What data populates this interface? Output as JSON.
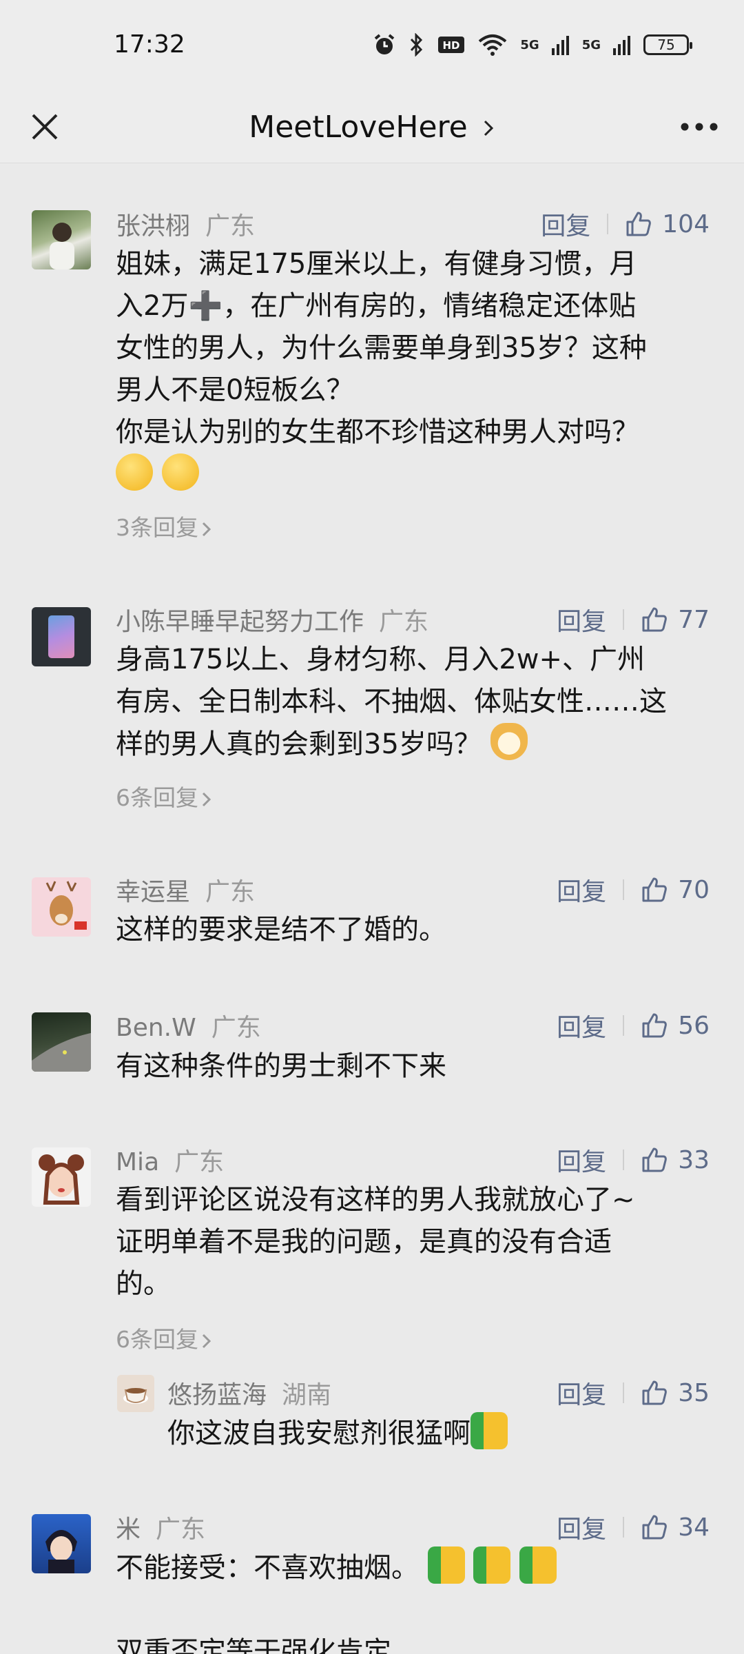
{
  "status": {
    "time": "17:32",
    "battery": "75",
    "network_1": "5G",
    "network_2": "5G"
  },
  "nav": {
    "title": "MeetLoveHere"
  },
  "reply_label": "回复",
  "comments": [
    {
      "name": "张洪栩",
      "region": "广东",
      "likes": "104",
      "lines": [
        "姐妹，满足175厘米以上，有健身习惯，月",
        "入2万➕，在广州有房的，情绪稳定还体贴",
        "女性的男人，为什么需要单身到35岁？这种",
        "男人不是0短板么？",
        "你是认为别的女生都不珍惜这种男人对吗？"
      ],
      "more": "3条回复"
    },
    {
      "name": "小陈早睡早起努力工作",
      "region": "广东",
      "likes": "77",
      "lines": [
        "身高175以上、身材匀称、月入2w+、广州",
        "有房、全日制本科、不抽烟、体贴女性……这",
        "样的男人真的会剩到35岁吗？"
      ],
      "more": "6条回复"
    },
    {
      "name": "幸运星",
      "region": "广东",
      "likes": "70",
      "lines": [
        "这样的要求是结不了婚的。"
      ]
    },
    {
      "name": "Ben.W",
      "region": "广东",
      "likes": "56",
      "lines": [
        "有这种条件的男士剩不下来"
      ]
    },
    {
      "name": "Mia",
      "region": "广东",
      "likes": "33",
      "lines": [
        "看到评论区说没有这样的男人我就放心了~",
        "证明单着不是我的问题，是真的没有合适",
        "的。"
      ],
      "more": "6条回复",
      "reply": {
        "name": "悠扬蓝海",
        "region": "湖南",
        "likes": "35",
        "text": "你这波自我安慰剂很猛啊"
      }
    },
    {
      "name": "米",
      "region": "广东",
      "likes": "34",
      "lines": [
        "不能接受：不喜欢抽烟。",
        "",
        "双重否定等于强化肯定"
      ]
    }
  ]
}
